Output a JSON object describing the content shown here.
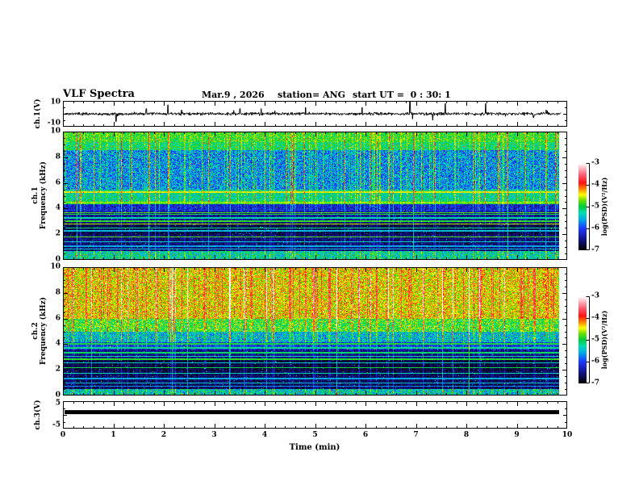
{
  "header": {
    "title": "VLF Spectra",
    "date": "Mar.9 , 2026",
    "station": "station= ANG",
    "start_ut": "start UT =  0 : 30: 1"
  },
  "panels": {
    "ch1_wave": {
      "ylabel": "ch.1(V)",
      "yticks": [
        "10",
        "-10"
      ]
    },
    "spec1": {
      "ylabel1": "ch.1",
      "ylabel2": "Frequency (kHz)",
      "yticks": [
        "10",
        "8",
        "6",
        "4",
        "2",
        "0"
      ]
    },
    "spec2": {
      "ylabel1": "ch.2",
      "ylabel2": "Frequency (kHz)",
      "yticks": [
        "10",
        "8",
        "6",
        "4",
        "2",
        "0"
      ]
    },
    "ch3_wave": {
      "ylabel": "ch.3(V)",
      "yticks": [
        "5",
        "-5"
      ]
    }
  },
  "xaxis": {
    "label": "Time (min)",
    "ticks": [
      "0",
      "1",
      "2",
      "3",
      "4",
      "5",
      "6",
      "7",
      "8",
      "9",
      "10"
    ]
  },
  "colorbar": {
    "label": "log(PSD)(V²/Hz)",
    "ticks": [
      "-3",
      "-4",
      "-5",
      "-6",
      "-7"
    ]
  },
  "chart_data": {
    "type": "heatmap",
    "title": "VLF Spectra",
    "date": "Mar.9 , 2026",
    "station": "ANG",
    "start_ut": "0:30:1",
    "xlabel": "Time (min)",
    "xlim": [
      0,
      10
    ],
    "data_end_min": 9.84,
    "colorbar": {
      "label": "log(PSD)(V²/Hz)",
      "zlim": [
        -7,
        -3
      ],
      "ticks": [
        -3,
        -4,
        -5,
        -6,
        -7
      ]
    },
    "colormap": {
      "values": [
        -7.0,
        -6.8,
        -6.5,
        -6.0,
        -5.6,
        -5.3,
        -5.0,
        -4.7,
        -4.45,
        -4.15,
        -3.9,
        -3.55,
        -3.25,
        -3.0
      ],
      "colors": [
        [
          0,
          0,
          0
        ],
        [
          10,
          10,
          60
        ],
        [
          20,
          20,
          140
        ],
        [
          30,
          60,
          255
        ],
        [
          0,
          170,
          230
        ],
        [
          0,
          220,
          180
        ],
        [
          0,
          205,
          60
        ],
        [
          110,
          225,
          0
        ],
        [
          255,
          255,
          0
        ],
        [
          255,
          120,
          0
        ],
        [
          255,
          20,
          20
        ],
        [
          255,
          90,
          110
        ],
        [
          255,
          175,
          190
        ],
        [
          255,
          255,
          255
        ]
      ]
    },
    "panels": [
      {
        "id": "ch1_voltage",
        "type": "line",
        "ylabel": "ch.1(V)",
        "ylim": [
          -10,
          10
        ],
        "noise_v": 0.7,
        "seed": 11,
        "spikes": [
          [
            1.02,
            -6
          ],
          [
            1.62,
            4
          ],
          [
            2.05,
            7
          ],
          [
            2.32,
            3
          ],
          [
            3.48,
            4
          ],
          [
            3.9,
            4
          ],
          [
            4.78,
            5
          ],
          [
            5.9,
            5
          ],
          [
            6.85,
            10
          ],
          [
            6.9,
            -4
          ],
          [
            7.3,
            -5
          ],
          [
            7.55,
            8
          ],
          [
            8.35,
            8
          ],
          [
            9.3,
            -3
          ],
          [
            9.55,
            3
          ]
        ]
      },
      {
        "id": "ch1_spectrogram",
        "type": "heatmap",
        "ylabel": "ch.1 Frequency (kHz)",
        "ylim": [
          0,
          10
        ],
        "zlim": [
          -7,
          -3
        ],
        "seed": 42,
        "bands": [
          [
            9.2,
            10.05,
            -4.9,
            0.35,
            0.5
          ],
          [
            8.6,
            9.2,
            -5.1,
            0.4,
            0.7
          ],
          [
            5.5,
            8.6,
            -5.7,
            0.55,
            1.0
          ],
          [
            4.65,
            5.5,
            -5.25,
            0.4,
            0.8
          ],
          [
            4.4,
            4.65,
            -5.0,
            0.3,
            0.6
          ],
          [
            3.8,
            4.4,
            -6.25,
            0.35,
            0.5
          ],
          [
            2.95,
            3.8,
            -6.5,
            0.3,
            0.4
          ],
          [
            1.95,
            2.95,
            -6.75,
            0.25,
            0.35
          ],
          [
            0.75,
            1.95,
            -6.6,
            0.3,
            0.35
          ],
          [
            0.0,
            0.75,
            -5.3,
            0.5,
            0.5
          ]
        ],
        "hlines": [
          [
            5.3,
            0.07,
            -4.5
          ],
          [
            4.5,
            0.06,
            -4.7
          ],
          [
            3.72,
            0.05,
            -4.8
          ],
          [
            3.6,
            0.04,
            -5.0
          ],
          [
            3.3,
            0.04,
            -5.3
          ],
          [
            3.05,
            0.04,
            -4.9
          ],
          [
            2.82,
            0.05,
            -4.6
          ],
          [
            2.5,
            0.04,
            -5.2
          ],
          [
            2.3,
            0.04,
            -5.5
          ],
          [
            1.82,
            0.05,
            -4.8
          ],
          [
            1.45,
            0.04,
            -5.4
          ],
          [
            1.1,
            0.04,
            -5.6
          ],
          [
            0.9,
            0.04,
            -5.5
          ]
        ]
      },
      {
        "id": "ch2_spectrogram",
        "type": "heatmap",
        "ylabel": "ch.2 Frequency (kHz)",
        "ylim": [
          0,
          10
        ],
        "zlim": [
          -7,
          -3
        ],
        "seed": 77,
        "bands": [
          [
            6.0,
            10.05,
            -4.45,
            0.45,
            1.0
          ],
          [
            5.0,
            6.0,
            -4.9,
            0.45,
            0.9
          ],
          [
            4.2,
            5.0,
            -5.5,
            0.5,
            0.8
          ],
          [
            3.6,
            4.2,
            -6.1,
            0.4,
            0.6
          ],
          [
            2.8,
            3.6,
            -6.55,
            0.3,
            0.45
          ],
          [
            1.9,
            2.8,
            -6.8,
            0.25,
            0.4
          ],
          [
            0.55,
            1.9,
            -6.7,
            0.3,
            0.4
          ],
          [
            0.0,
            0.55,
            -5.4,
            0.55,
            0.5
          ]
        ],
        "hlines": [
          [
            4.05,
            0.05,
            -5.0
          ],
          [
            3.75,
            0.04,
            -5.2
          ],
          [
            3.35,
            0.05,
            -5.1
          ],
          [
            3.1,
            0.04,
            -5.3
          ],
          [
            2.85,
            0.05,
            -4.9
          ],
          [
            2.6,
            0.04,
            -5.4
          ],
          [
            2.2,
            0.05,
            -5.0
          ],
          [
            1.75,
            0.04,
            -5.3
          ],
          [
            1.35,
            0.04,
            -5.6
          ],
          [
            1.0,
            0.04,
            -5.5
          ],
          [
            0.75,
            0.04,
            -5.7
          ]
        ]
      },
      {
        "id": "ch3_voltage",
        "type": "line",
        "ylabel": "ch.3(V)",
        "ylim": [
          -5,
          5
        ],
        "constant_value": 1.0,
        "line_thickness_px": 5
      }
    ]
  }
}
